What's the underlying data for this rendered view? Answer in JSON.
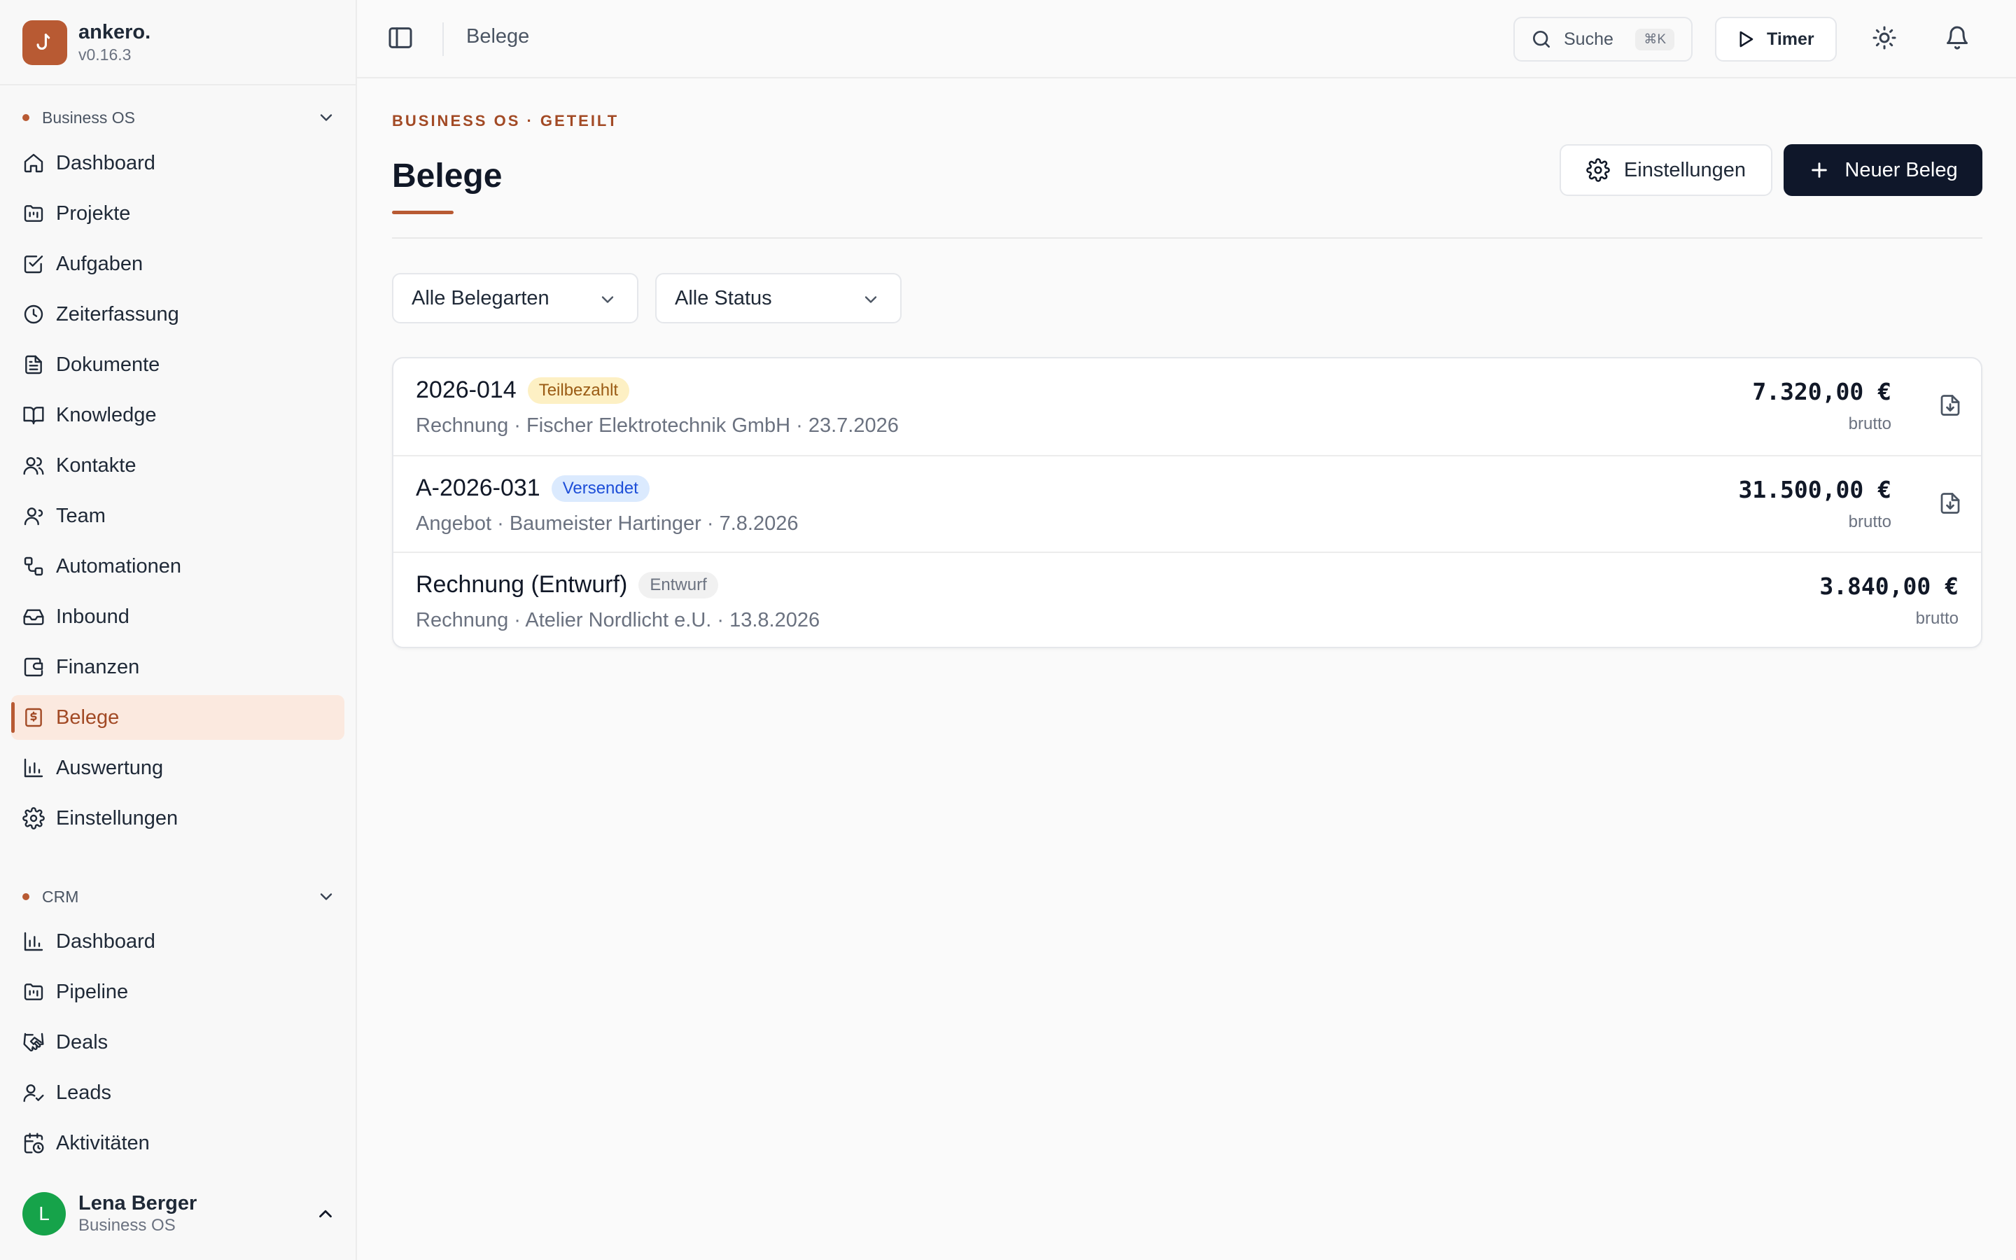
{
  "app": {
    "name": "ankero.",
    "version": "v0.16.3",
    "logo_glyph": "↩"
  },
  "sidebar": {
    "groups": [
      {
        "label": "Business OS",
        "items": [
          {
            "label": "Dashboard",
            "icon": "home-icon"
          },
          {
            "label": "Projekte",
            "icon": "folder-kanban-icon"
          },
          {
            "label": "Aufgaben",
            "icon": "check-square-icon"
          },
          {
            "label": "Zeiterfassung",
            "icon": "clock-icon"
          },
          {
            "label": "Dokumente",
            "icon": "file-text-icon"
          },
          {
            "label": "Knowledge",
            "icon": "book-open-icon"
          },
          {
            "label": "Kontakte",
            "icon": "users-icon"
          },
          {
            "label": "Team",
            "icon": "user-icon"
          },
          {
            "label": "Automationen",
            "icon": "workflow-icon"
          },
          {
            "label": "Inbound",
            "icon": "inbox-icon"
          },
          {
            "label": "Finanzen",
            "icon": "wallet-icon"
          },
          {
            "label": "Belege",
            "icon": "receipt-icon",
            "active": true
          },
          {
            "label": "Auswertung",
            "icon": "bar-chart-icon"
          },
          {
            "label": "Einstellungen",
            "icon": "gear-icon"
          }
        ]
      },
      {
        "label": "CRM",
        "items": [
          {
            "label": "Dashboard",
            "icon": "bar-chart-icon"
          },
          {
            "label": "Pipeline",
            "icon": "folder-kanban-icon"
          },
          {
            "label": "Deals",
            "icon": "handshake-icon"
          },
          {
            "label": "Leads",
            "icon": "user-check-icon"
          },
          {
            "label": "Aktivitäten",
            "icon": "calendar-clock-icon"
          }
        ]
      }
    ],
    "user": {
      "initial": "L",
      "name": "Lena Berger",
      "workspace": "Business OS"
    }
  },
  "topbar": {
    "breadcrumb": "Belege",
    "search": {
      "label": "Suche",
      "shortcut": "⌘K"
    },
    "timer_label": "Timer"
  },
  "page": {
    "eyebrow": "BUSINESS OS · GETEILT",
    "title": "Belege",
    "settings_button": "Einstellungen",
    "new_button": "Neuer Beleg",
    "filters": {
      "type": "Alle Belegarten",
      "status": "Alle Status"
    }
  },
  "documents": [
    {
      "title": "2026-014",
      "badge": "Teilbezahlt",
      "badge_kind": "paid",
      "subtitle": "Rechnung · Fischer Elektrotechnik GmbH · 23.7.2026",
      "amount": "7.320,00 €",
      "amount_note": "brutto",
      "has_download": true
    },
    {
      "title": "A-2026-031",
      "badge": "Versendet",
      "badge_kind": "sent",
      "subtitle": "Angebot · Baumeister Hartinger · 7.8.2026",
      "amount": "31.500,00 €",
      "amount_note": "brutto",
      "has_download": true
    },
    {
      "title": "Rechnung (Entwurf)",
      "badge": "Entwurf",
      "badge_kind": "draft",
      "subtitle": "Rechnung · Atelier Nordlicht e.U. · 13.8.2026",
      "amount": "3.840,00 €",
      "amount_note": "brutto",
      "has_download": false
    }
  ],
  "colors": {
    "accent": "#b85a33",
    "primary_button": "#0f172a",
    "active_nav_bg": "#fbe9df",
    "avatar": "#16a34a"
  }
}
